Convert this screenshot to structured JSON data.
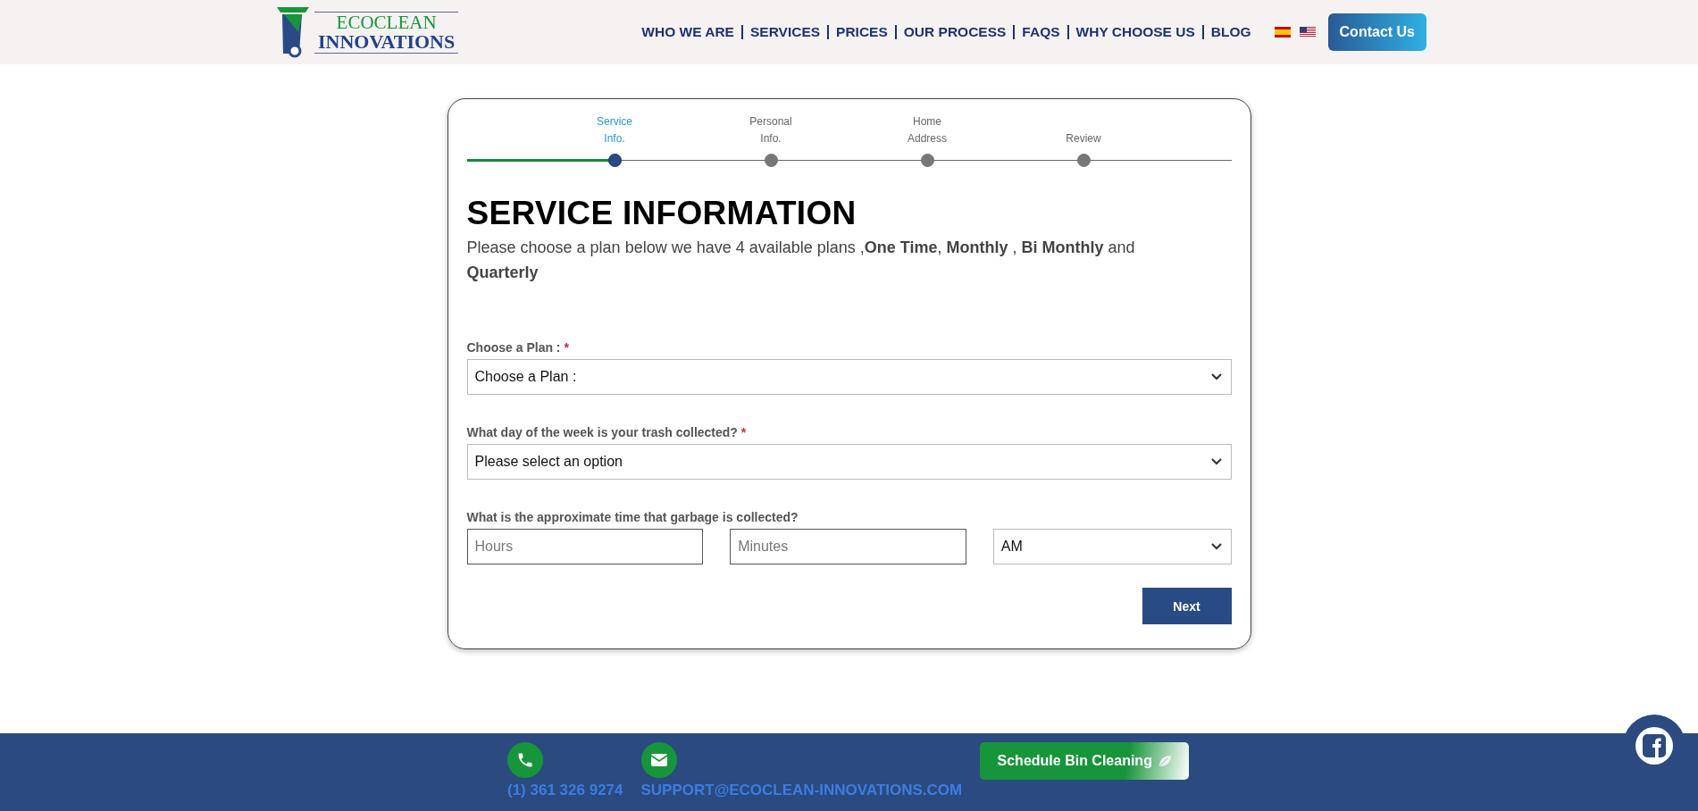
{
  "header": {
    "logo": {
      "line_1": "ECOCLEAN",
      "line_2": "INNOVATIONS"
    },
    "nav": [
      {
        "label": "WHO WE ARE"
      },
      {
        "label": "SERVICES"
      },
      {
        "label": "PRICES"
      },
      {
        "label": "OUR PROCESS"
      },
      {
        "label": "FAQS"
      },
      {
        "label": "WHY CHOOSE US"
      },
      {
        "label": "BLOG"
      }
    ],
    "contact_button": "Contact Us"
  },
  "steps": [
    {
      "label": "Service Info.",
      "selected": true
    },
    {
      "label": "Personal Info.",
      "selected": false
    },
    {
      "label": "Home Address",
      "selected": false
    },
    {
      "label": "Review",
      "selected": false
    }
  ],
  "form": {
    "title": "SERVICE INFORMATION",
    "intro": "Please choose a plan below we have 4 available plans ,**One Time**, **Monthly** , **Bi Monthly** and **Quarterly**",
    "fields": [
      {
        "kind": "select",
        "label": "Choose a Plan :",
        "required_mark": "*",
        "value": "Choose a Plan :"
      },
      {
        "kind": "select",
        "label": "What day of the week is your trash collected?",
        "required_mark": "*",
        "value": "Please select an option"
      },
      {
        "kind": "time",
        "label": "What is the approximate time that garbage is collected?",
        "hours_placeholder": "Hours",
        "minutes_placeholder": "Minutes",
        "period": "AM"
      }
    ],
    "next_button": "Next"
  },
  "footer": {
    "phone": "(1) 361 326 9274",
    "email": "SUPPORT@ECOCLEAN-INNOVATIONS.COM",
    "schedule_button": "Schedule Bin Cleaning"
  }
}
